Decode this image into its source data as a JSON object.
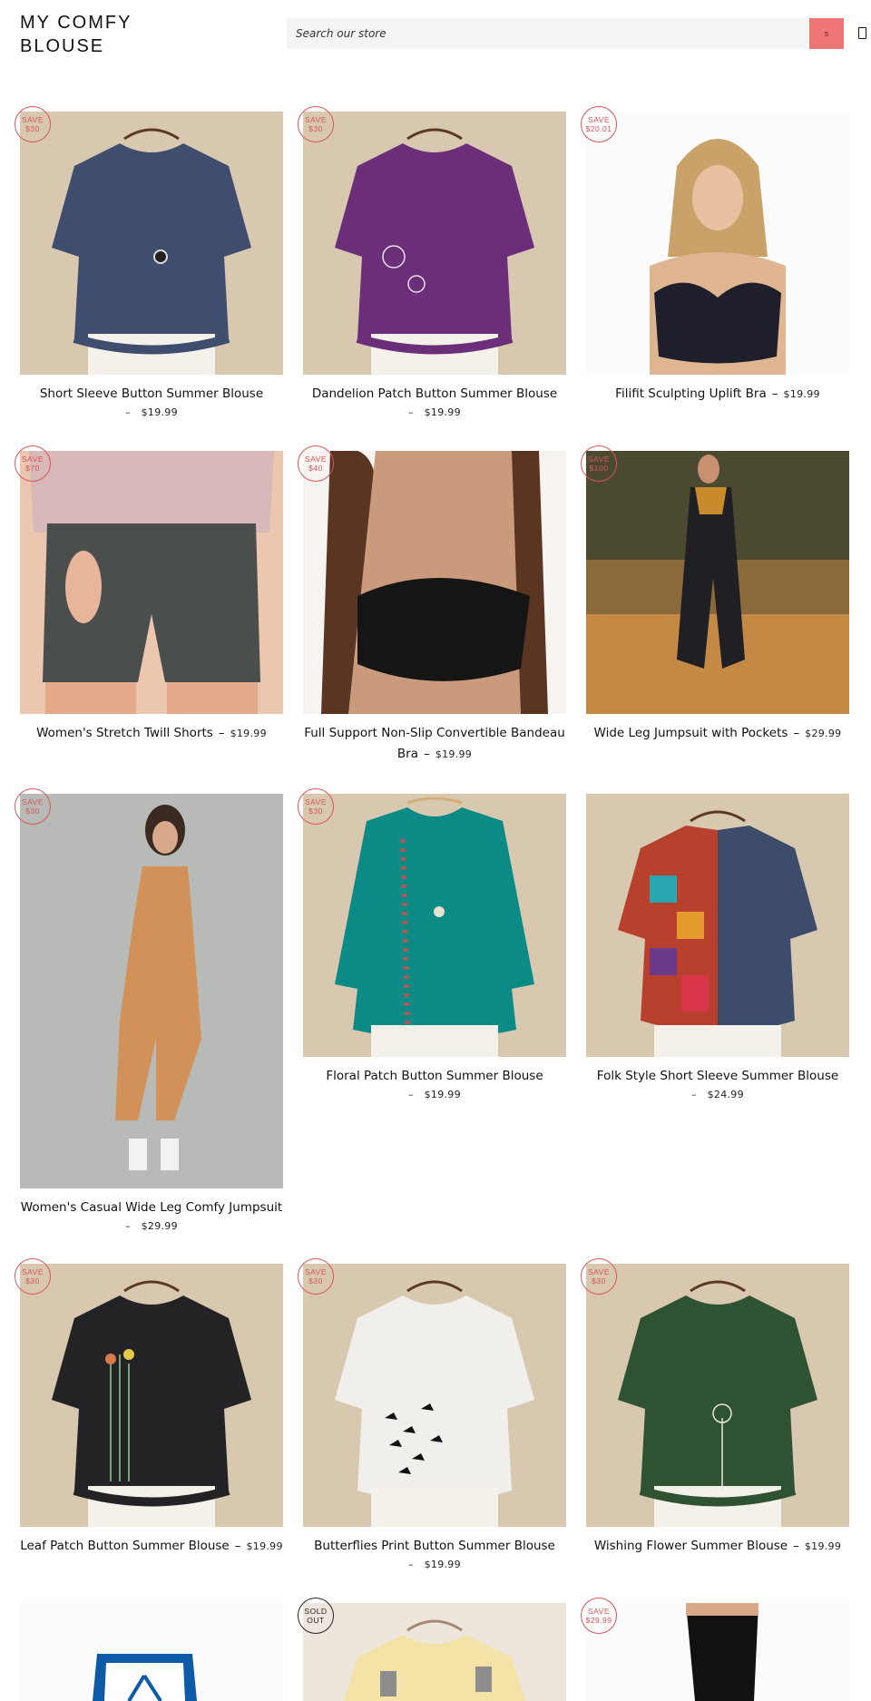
{
  "store": {
    "name_line1": "MY COMFY",
    "name_line2": "BLOUSE"
  },
  "search": {
    "placeholder": "Search our store",
    "button_label": "s"
  },
  "products": [
    {
      "title": "Short Sleeve Button Summer Blouse",
      "dash": "–",
      "price": "$19.99",
      "badge_line1": "SAVE",
      "badge_line2": "$30"
    },
    {
      "title": "Dandelion Patch Button Summer Blouse",
      "dash": "–",
      "price": "$19.99",
      "badge_line1": "SAVE",
      "badge_line2": "$30"
    },
    {
      "title": "Filifit Sculpting Uplift Bra",
      "dash": "–",
      "price": "$19.99",
      "badge_line1": "SAVE",
      "badge_line2": "$20.01"
    },
    {
      "title": "Women's Stretch Twill Shorts",
      "dash": "–",
      "price": "$19.99",
      "badge_line1": "SAVE",
      "badge_line2": "$70"
    },
    {
      "title_line1": "Full Support Non-Slip Convertible Bandeau",
      "title_line2": "Bra",
      "dash": "–",
      "price": "$19.99",
      "badge_line1": "SAVE",
      "badge_line2": "$40"
    },
    {
      "title": "Wide Leg Jumpsuit with Pockets",
      "dash": "–",
      "price": "$29.99",
      "badge_line1": "SAVE",
      "badge_line2": "$100"
    },
    {
      "title": "Women's Casual Wide Leg Comfy Jumpsuit",
      "dash": "–",
      "price": "$29.99",
      "badge_line1": "SAVE",
      "badge_line2": "$30"
    },
    {
      "title": "Floral Patch Button Summer Blouse",
      "dash": "–",
      "price": "$19.99",
      "badge_line1": "SAVE",
      "badge_line2": "$30"
    },
    {
      "title": "Folk Style Short Sleeve Summer Blouse",
      "dash": "–",
      "price": "$24.99"
    },
    {
      "title": "Leaf Patch Button Summer Blouse",
      "dash": "–",
      "price": "$19.99",
      "badge_line1": "SAVE",
      "badge_line2": "$30"
    },
    {
      "title": "Butterflies Print Button Summer Blouse",
      "dash": "–",
      "price": "$19.99",
      "badge_line1": "SAVE",
      "badge_line2": "$30"
    },
    {
      "title": "Wishing Flower Summer Blouse",
      "dash": "–",
      "price": "$19.99",
      "badge_line1": "SAVE",
      "badge_line2": "$30"
    },
    {
      "badge_line1": "",
      "badge_line2": ""
    },
    {
      "badge_line1": "SOLD",
      "badge_line2": "OUT"
    },
    {
      "badge_line1": "SAVE",
      "badge_line2": "$29.99"
    }
  ],
  "colors": {
    "accent": "#f07575",
    "badge": "#d8555a",
    "text": "#111111"
  },
  "icons": {
    "search": "search-icon",
    "cart": "cart-icon"
  }
}
